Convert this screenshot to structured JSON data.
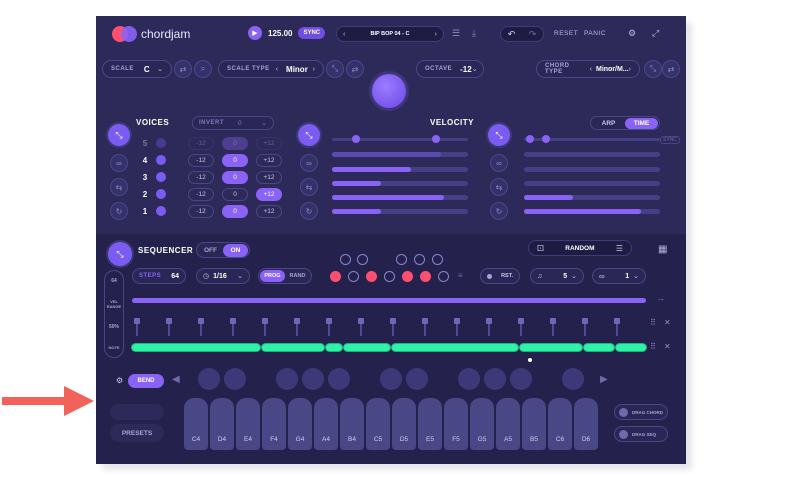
{
  "header": {
    "logo": "chordjam",
    "bpm": "125.00",
    "sync": "SYNC",
    "preset_name": "BIP BOP 04 - C",
    "reset": "RESET",
    "panic": "PANIC"
  },
  "controls": {
    "scale_label": "SCALE",
    "scale_value": "C",
    "scale_type_label": "SCALE TYPE",
    "scale_type_value": "Minor",
    "octave_label": "OCTAVE",
    "octave_value": "-12",
    "chord_type_label": "CHORD TYPE",
    "chord_type_value": "Minor/M..."
  },
  "voices": {
    "title": "VOICES",
    "invert_label": "INVERT",
    "invert_value": "0",
    "rows": [
      {
        "num": "5",
        "left": "-12",
        "mid": "0",
        "right": "+12"
      },
      {
        "num": "4",
        "left": "-12",
        "mid": "0",
        "right": "+12"
      },
      {
        "num": "3",
        "left": "-12",
        "mid": "0",
        "right": "+12"
      },
      {
        "num": "2",
        "left": "-12",
        "mid": "0",
        "right": "+12"
      },
      {
        "num": "1",
        "left": "-12",
        "mid": "0",
        "right": "+12"
      }
    ]
  },
  "velocity": {
    "title": "VELOCITY"
  },
  "arp": {
    "arp_label": "ARP",
    "time_label": "TIME",
    "sync_label": "SYNC"
  },
  "sequencer": {
    "title": "SEQUENCER",
    "off": "OFF",
    "on": "ON",
    "steps_label": "STEPS",
    "steps_value": "64",
    "rate_value": "1/16",
    "prog": "PROG",
    "rand": "RAND",
    "random_label": "RANDOM",
    "rst": "RST.",
    "count_a": "5",
    "count_b": "1",
    "side_top": "64",
    "side_mid": "VEL RANGE",
    "side_bottom": "50%",
    "side_foot": "NOTE"
  },
  "keyboard": {
    "bend_label": "BEND",
    "presets": "PRESETS",
    "keys": [
      "C4",
      "D4",
      "E4",
      "F4",
      "G4",
      "A4",
      "B4",
      "C5",
      "D5",
      "E5",
      "F5",
      "G5",
      "A5",
      "B5",
      "C6",
      "D6"
    ],
    "drag_chord": "DRAG CHORD",
    "drag_seq": "DRAG SEQ"
  },
  "colors": {
    "bg": "#2d2a5a",
    "accent": "#8a63f6",
    "red": "#ff4f6e",
    "green": "#2ef2a6",
    "arrow": "#f0625a"
  }
}
